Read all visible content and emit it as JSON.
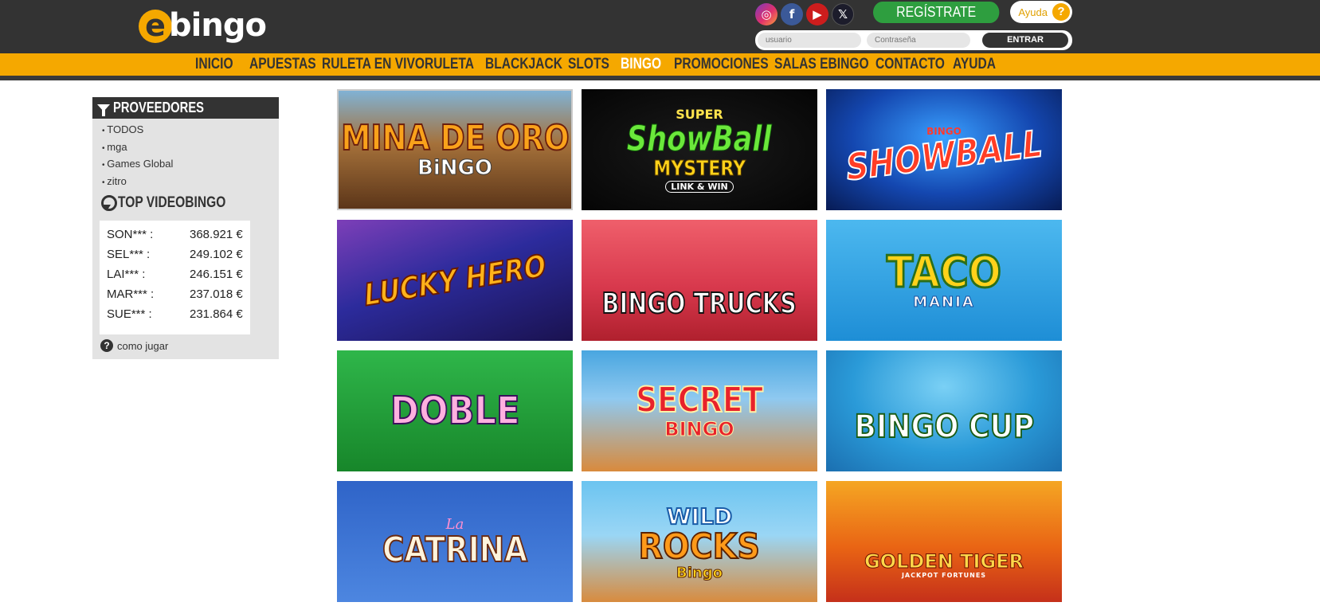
{
  "brand": {
    "logo_e": "e",
    "logo_text": "bingo",
    "accent": "#f5a800",
    "dark": "#333333",
    "green": "#2e9e3f"
  },
  "header": {
    "socials": [
      {
        "name": "instagram-icon",
        "glyph": "◎"
      },
      {
        "name": "facebook-icon",
        "glyph": "f"
      },
      {
        "name": "youtube-icon",
        "glyph": "▶"
      },
      {
        "name": "x-icon",
        "glyph": "𝕏"
      }
    ],
    "register_label": "REGÍSTRATE",
    "help_label": "Ayuda",
    "help_icon": "?",
    "login": {
      "user_placeholder": "usuario",
      "password_placeholder": "Contraseña",
      "submit_label": "ENTRAR"
    }
  },
  "nav": {
    "items": [
      "INICIO",
      "APUESTAS",
      "RULETA EN VIVO",
      "RULETA",
      "BLACKJACK",
      "SLOTS",
      "BINGO",
      "PROMOCIONES",
      "SALAS EBINGO",
      "CONTACTO",
      "AYUDA"
    ],
    "active": "BINGO"
  },
  "sidebar": {
    "providers_title": "PROVEEDORES",
    "providers": [
      "TODOS",
      "mga",
      "Games Global",
      "zitro"
    ],
    "top_title": "TOP VIDEOBINGO",
    "top": [
      {
        "name": "SON*** :",
        "amount": "368.921 €"
      },
      {
        "name": "SEL*** :",
        "amount": "249.102 €"
      },
      {
        "name": "LAI*** :",
        "amount": "246.151 €"
      },
      {
        "name": "MAR*** :",
        "amount": "237.018 €"
      },
      {
        "name": "SUE*** :",
        "amount": "231.864 €"
      }
    ],
    "how_to_play": "como jugar"
  },
  "games": [
    {
      "title": "MINA DE ORO",
      "sub": "BiNGO"
    },
    {
      "pre": "SUPER",
      "title": "ShowBall",
      "sub": "MYSTERY",
      "sub2": "LINK & WIN"
    },
    {
      "pre": "BINGO",
      "title": "SHOWBALL"
    },
    {
      "title": "LUCKY HERO"
    },
    {
      "title": "BINGO TRUCKS"
    },
    {
      "title": "TACO",
      "sub": "MANIA"
    },
    {
      "title": "DOBLE"
    },
    {
      "title": "SECRET",
      "sub": "BINGO"
    },
    {
      "title": "BINGO CUP"
    },
    {
      "pre": "La",
      "title": "CATRINA"
    },
    {
      "pre": "WILD",
      "title": "ROCKS",
      "sub": "Bingo"
    },
    {
      "title": "GOLDEN TIGER",
      "sub": "JACKPOT FORTUNES"
    }
  ]
}
